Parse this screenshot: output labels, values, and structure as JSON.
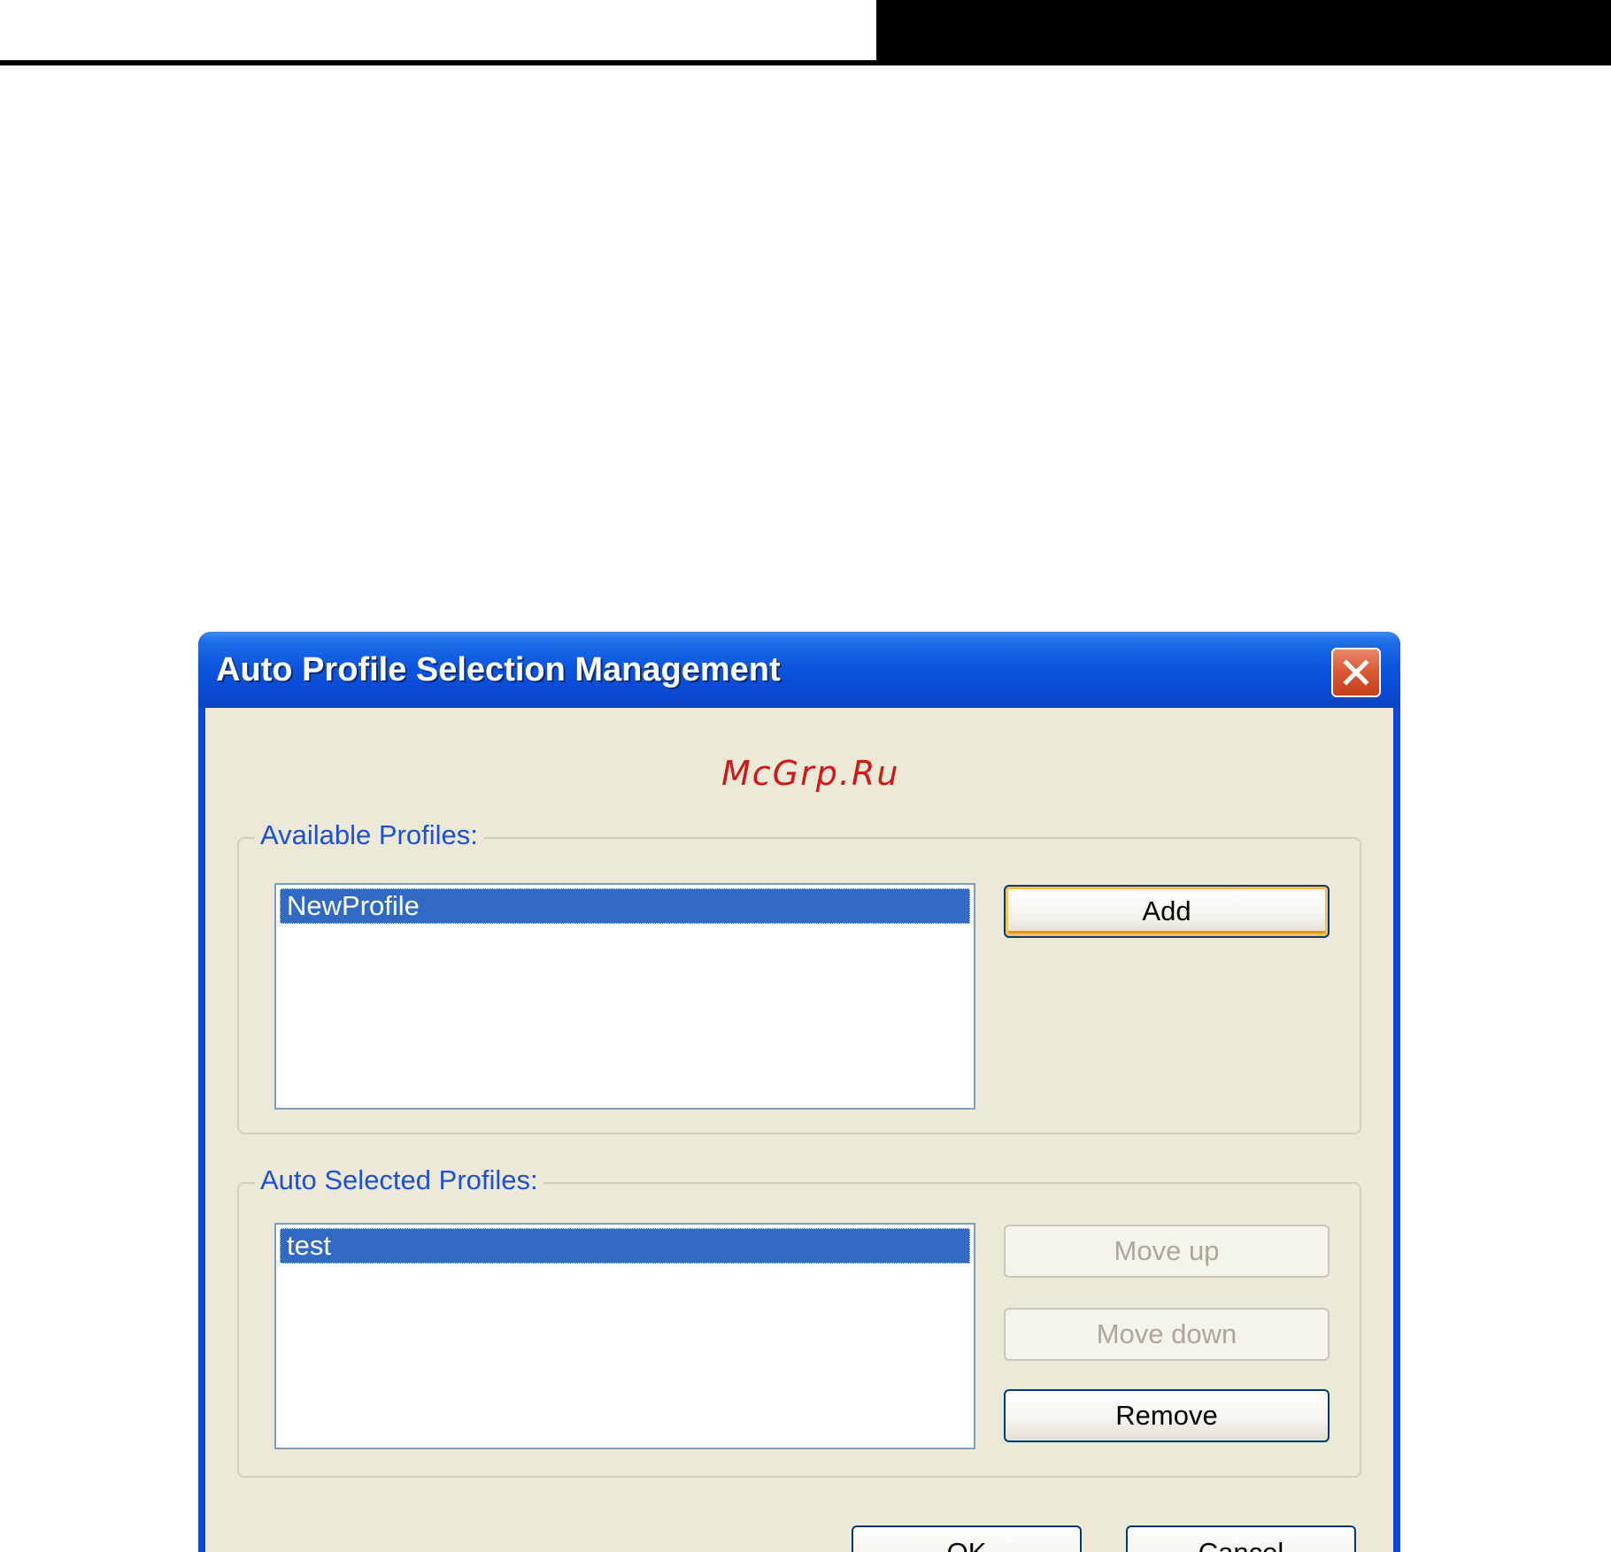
{
  "window": {
    "title": "Auto Profile Selection Management"
  },
  "watermark": "McGrp.Ru",
  "available": {
    "label": "Available Profiles:",
    "items": [
      "NewProfile"
    ],
    "add_label": "Add"
  },
  "auto_selected": {
    "label": "Auto Selected Profiles:",
    "items": [
      "test"
    ],
    "move_up_label": "Move up",
    "move_down_label": "Move down",
    "remove_label": "Remove"
  },
  "footer": {
    "ok_label": "OK",
    "cancel_label": "Cancel"
  },
  "colors": {
    "titlebar": "#0a4bd6",
    "selection": "#316ac5",
    "group_label": "#1c50d8",
    "client_bg": "#ece9d8",
    "watermark": "#d01818"
  },
  "icons": {
    "close": "close-icon"
  }
}
